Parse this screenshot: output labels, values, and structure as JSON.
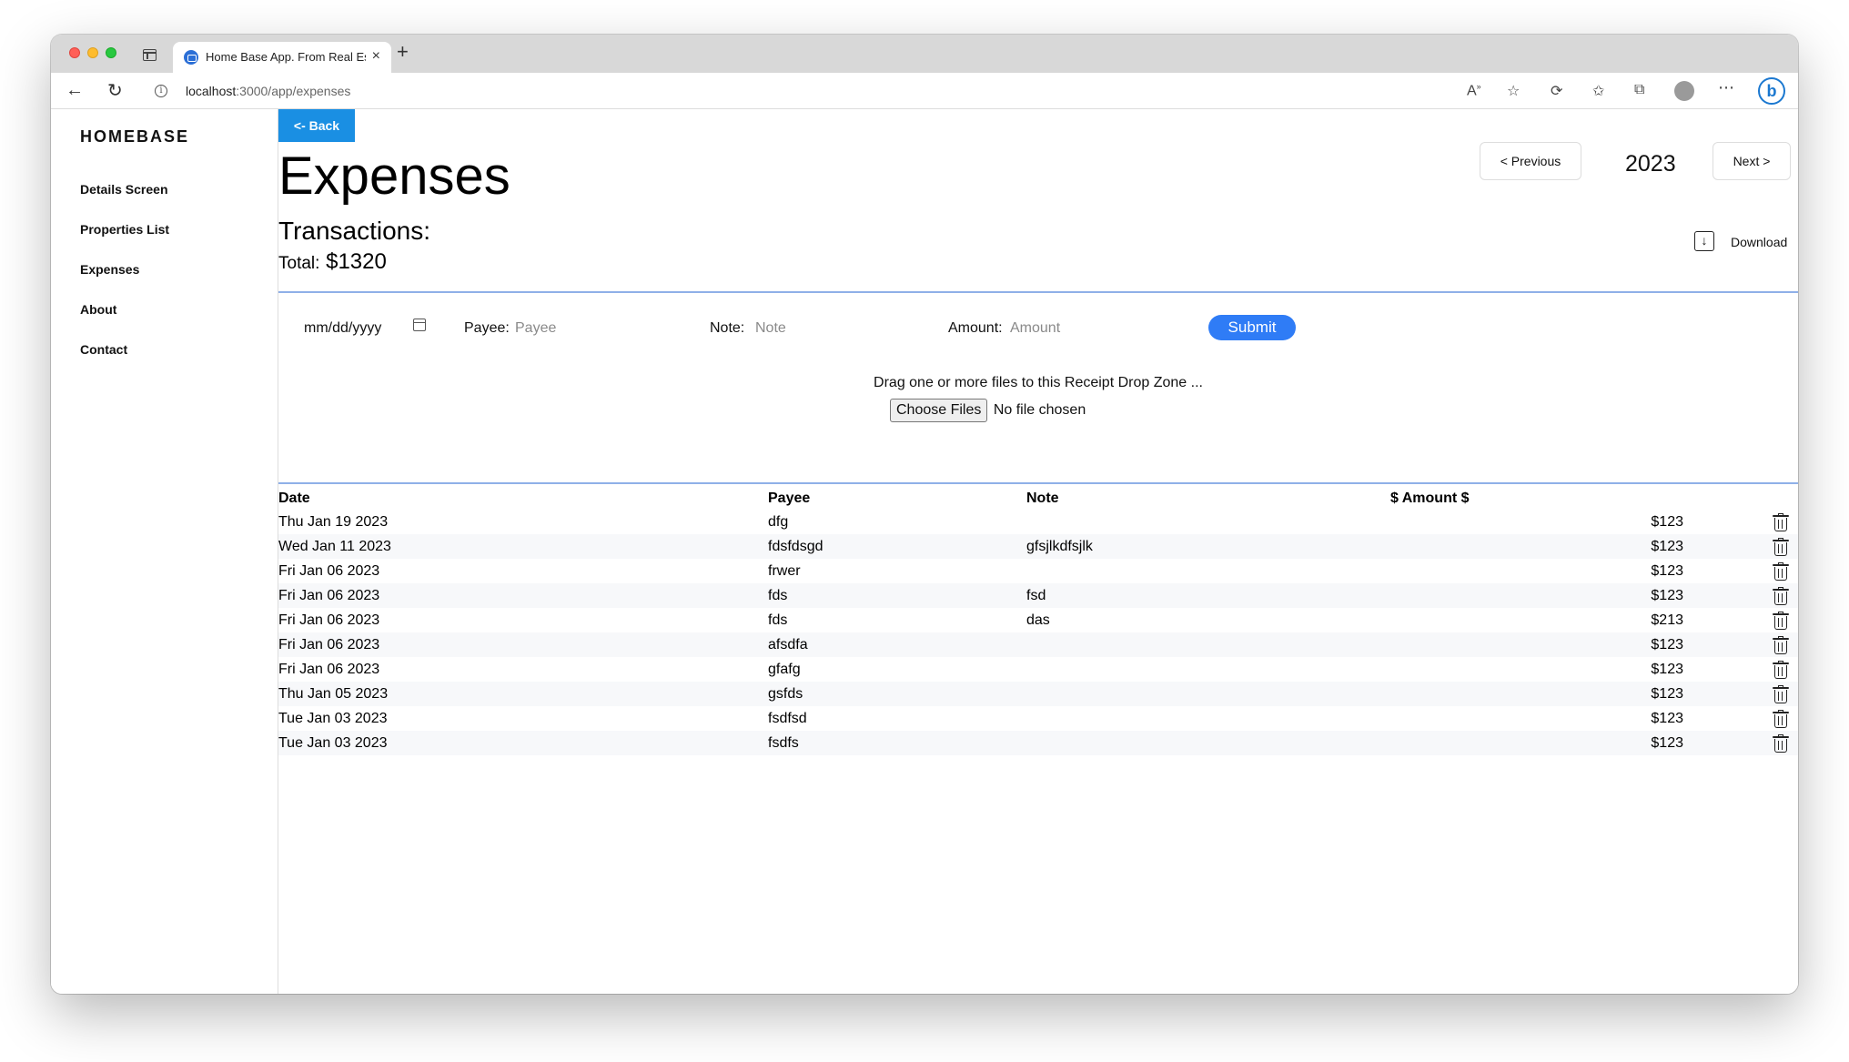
{
  "browser": {
    "tab_title": "Home Base App. From Real Estate",
    "tab_close": "×",
    "new_tab": "+",
    "url_host": "localhost",
    "url_path": ":3000/app/expenses",
    "back_glyph": "←",
    "reload_glyph": "↻",
    "toolbar_icons": [
      "read-aloud-icon",
      "favorite-add-icon",
      "extensions-icon",
      "favorites-icon",
      "collections-icon",
      "profile-icon",
      "more-icon",
      "bing-icon"
    ]
  },
  "sidebar": {
    "brand": "HOMEBASE",
    "items": [
      {
        "label": "Details Screen"
      },
      {
        "label": "Properties List"
      },
      {
        "label": "Expenses"
      },
      {
        "label": "About"
      },
      {
        "label": "Contact"
      }
    ]
  },
  "header": {
    "back_label": "<- Back",
    "title": "Expenses",
    "prev_label": "< Previous",
    "year": "2023",
    "next_label": "Next >"
  },
  "summary": {
    "transactions_label": "Transactions:",
    "total_label": "Total:",
    "total_value": "$1320",
    "download_label": "Download"
  },
  "form": {
    "date_placeholder": "mm/dd/yyyy",
    "payee_label": "Payee:",
    "payee_placeholder": "Payee",
    "note_label": "Note:",
    "note_placeholder": "Note",
    "amount_label": "Amount:",
    "amount_placeholder": "Amount",
    "submit_label": "Submit"
  },
  "dropzone": {
    "text": "Drag one or more files to this Receipt Drop Zone ...",
    "choose_label": "Choose Files",
    "no_file": "No file chosen"
  },
  "table": {
    "headers": {
      "date": "Date",
      "payee": "Payee",
      "note": "Note",
      "amount": "$ Amount $"
    },
    "rows": [
      {
        "date": "Thu Jan 19 2023",
        "payee": "dfg",
        "note": "",
        "amount": "$123"
      },
      {
        "date": "Wed Jan 11 2023",
        "payee": "fdsfdsgd",
        "note": "gfsjlkdfsjlk",
        "amount": "$123"
      },
      {
        "date": "Fri Jan 06 2023",
        "payee": "frwer",
        "note": "",
        "amount": "$123"
      },
      {
        "date": "Fri Jan 06 2023",
        "payee": "fds",
        "note": "fsd",
        "amount": "$123"
      },
      {
        "date": "Fri Jan 06 2023",
        "payee": "fds",
        "note": "das",
        "amount": "$213"
      },
      {
        "date": "Fri Jan 06 2023",
        "payee": "afsdfa",
        "note": "",
        "amount": "$123"
      },
      {
        "date": "Fri Jan 06 2023",
        "payee": "gfafg",
        "note": "",
        "amount": "$123"
      },
      {
        "date": "Thu Jan 05 2023",
        "payee": "gsfds",
        "note": "",
        "amount": "$123"
      },
      {
        "date": "Tue Jan 03 2023",
        "payee": "fsdfsd",
        "note": "",
        "amount": "$123"
      },
      {
        "date": "Tue Jan 03 2023",
        "payee": "fsdfs",
        "note": "",
        "amount": "$123"
      }
    ]
  },
  "colors": {
    "back_button": "#1a8fe3",
    "submit_button": "#2f7cf6",
    "divider": "#8fb0e8"
  }
}
